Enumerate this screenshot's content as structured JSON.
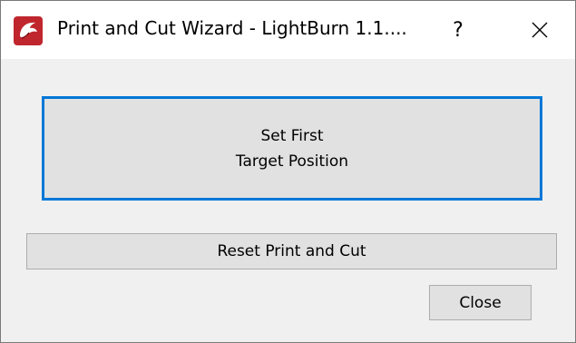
{
  "window": {
    "title": "Print and Cut Wizard - LightBurn 1.1....",
    "help_label": "?",
    "app_icon": "lightburn-logo-icon",
    "close_icon": "close-icon"
  },
  "buttons": {
    "set_first_line1": "Set First",
    "set_first_line2": "Target Position",
    "reset": "Reset Print and Cut",
    "close": "Close"
  },
  "colors": {
    "focus_border": "#0078d7",
    "button_bg": "#e1e1e1",
    "window_bg": "#f0f0f0",
    "icon_red": "#c0262d"
  }
}
